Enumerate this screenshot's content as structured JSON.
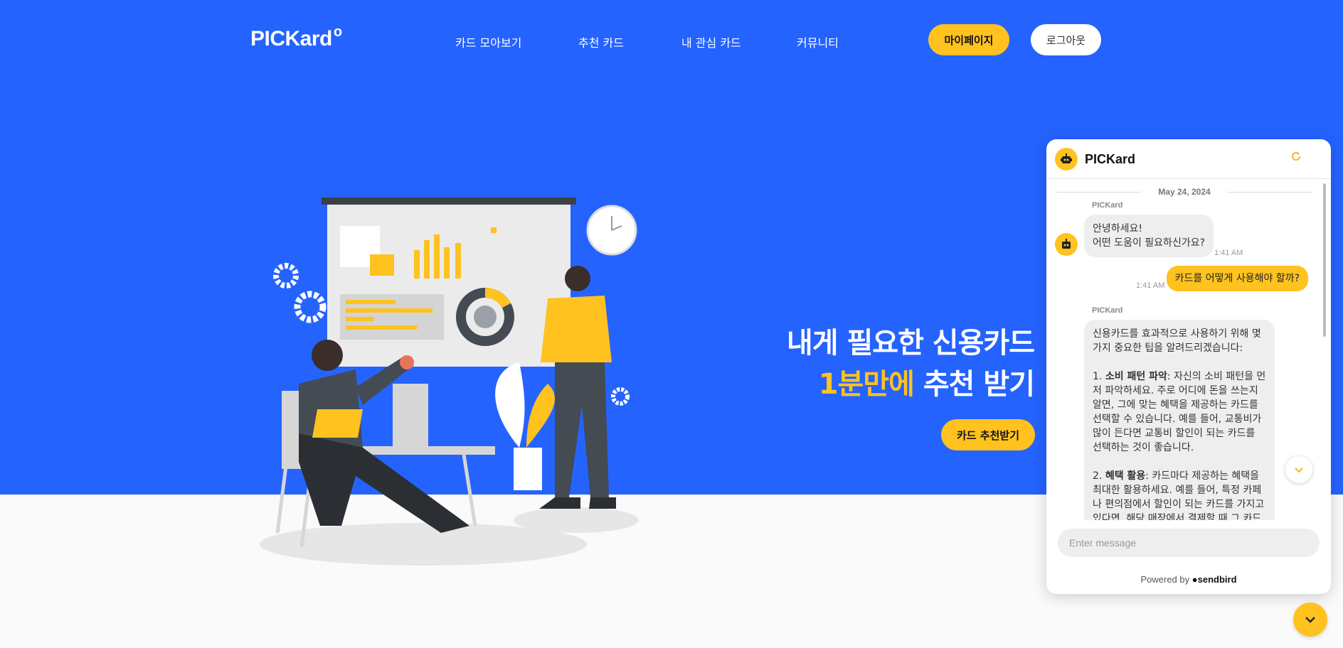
{
  "nav": {
    "logo": "PICKard",
    "logo_mark": "o",
    "links": [
      "카드 모아보기",
      "추천 카드",
      "내 관심 카드",
      "커뮤니티"
    ],
    "mypage_label": "마이페이지",
    "logout_label": "로그아웃"
  },
  "hero": {
    "line1": "내게 필요한 신용카드",
    "line2_highlight": "1분만에",
    "line2_rest": " 추천 받기",
    "cta_label": "카드 추천받기"
  },
  "chat": {
    "title": "PICKard",
    "date": "May 24, 2024",
    "messages": [
      {
        "from": "bot",
        "sender": "PICKard",
        "lines": [
          "안녕하세요!",
          "어떤 도움이 필요하신가요?"
        ],
        "time": "1:41 AM"
      },
      {
        "from": "user",
        "text": "카드를 어떻게 사용해야 할까?",
        "time": "1:41 AM"
      },
      {
        "from": "bot",
        "sender": "PICKard",
        "intro": "신용카드를 효과적으로 사용하기 위해 몇 가지 중요한 팁을 알려드리겠습니다:",
        "item1_num": "1. ",
        "item1_bold": "소비 패턴 파악",
        "item1_text": ": 자신의 소비 패턴을 먼저 파악하세요. 주로 어디에 돈을 쓰는지 알면, 그에 맞는 혜택을 제공하는 카드를 선택할 수 있습니다. 예를 들어, 교통비가 많이 든다면 교통비 할인이 되는 카드를 선택하는 것이 좋습니다.",
        "item2_num": "2. ",
        "item2_bold": "혜택 활용",
        "item2_text": ": 카드마다 제공하는 혜택을 최대한 활용하세요. 예를 들어, 특정 카페나 편의점에서 할인이 되는 카드를 가지고 있다면, 해당 매장에서 결제할 때 그 카드를 사"
      }
    ],
    "input_placeholder": "Enter message",
    "powered_prefix": "Powered by",
    "powered_brand": "sendbird"
  },
  "colors": {
    "primary_blue": "#2563ff",
    "accent_yellow": "#ffc21f"
  }
}
